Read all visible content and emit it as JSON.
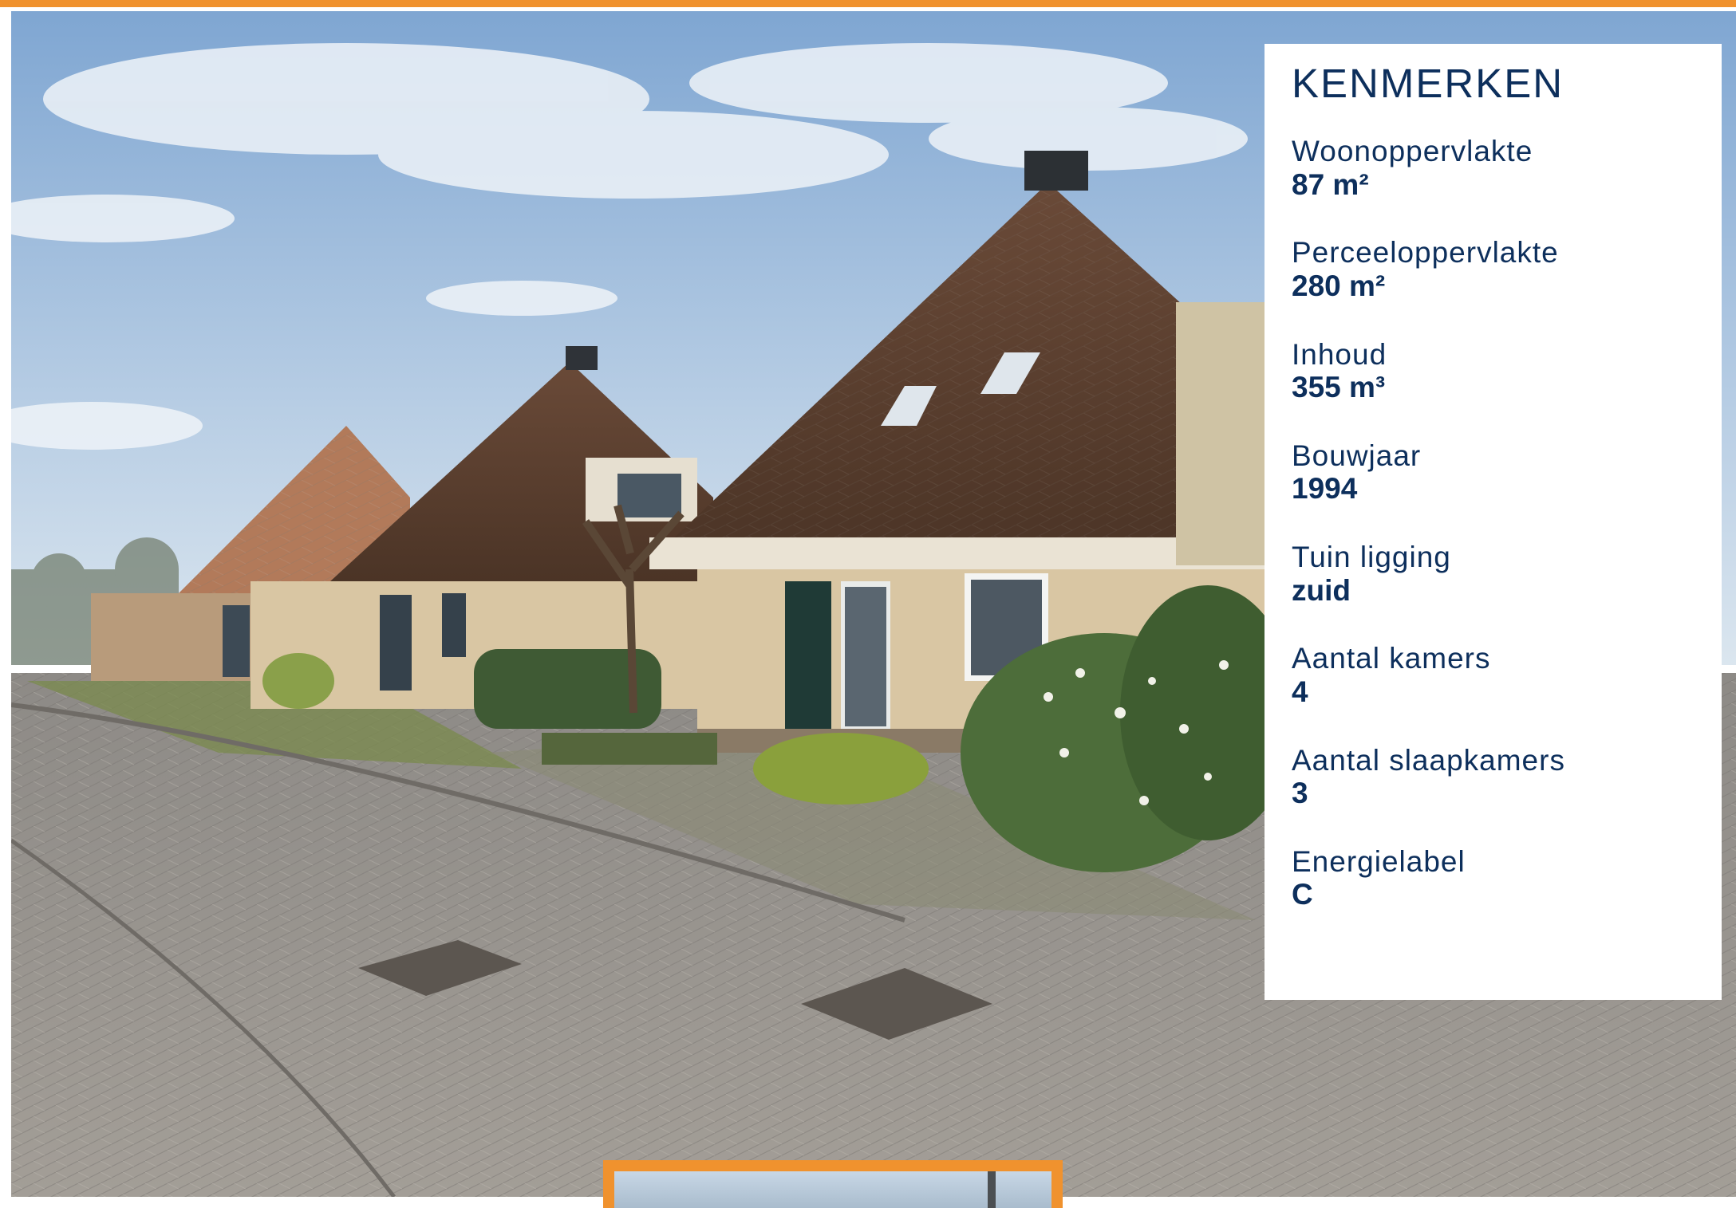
{
  "panel": {
    "title": "KENMERKEN",
    "features": [
      {
        "label": "Woonoppervlakte",
        "value": "87 m²"
      },
      {
        "label": "Perceeloppervlakte",
        "value": "280 m²"
      },
      {
        "label": "Inhoud",
        "value": "355 m³"
      },
      {
        "label": "Bouwjaar",
        "value": "1994"
      },
      {
        "label": "Tuin ligging",
        "value": "zuid"
      },
      {
        "label": "Aantal kamers",
        "value": "4"
      },
      {
        "label": "Aantal slaapkamers",
        "value": "3"
      },
      {
        "label": "Energielabel",
        "value": "C"
      }
    ]
  },
  "colors": {
    "accent": "#f0922e",
    "text": "#0d2f5c"
  },
  "photo": {
    "subject": "house-exterior-photo"
  }
}
